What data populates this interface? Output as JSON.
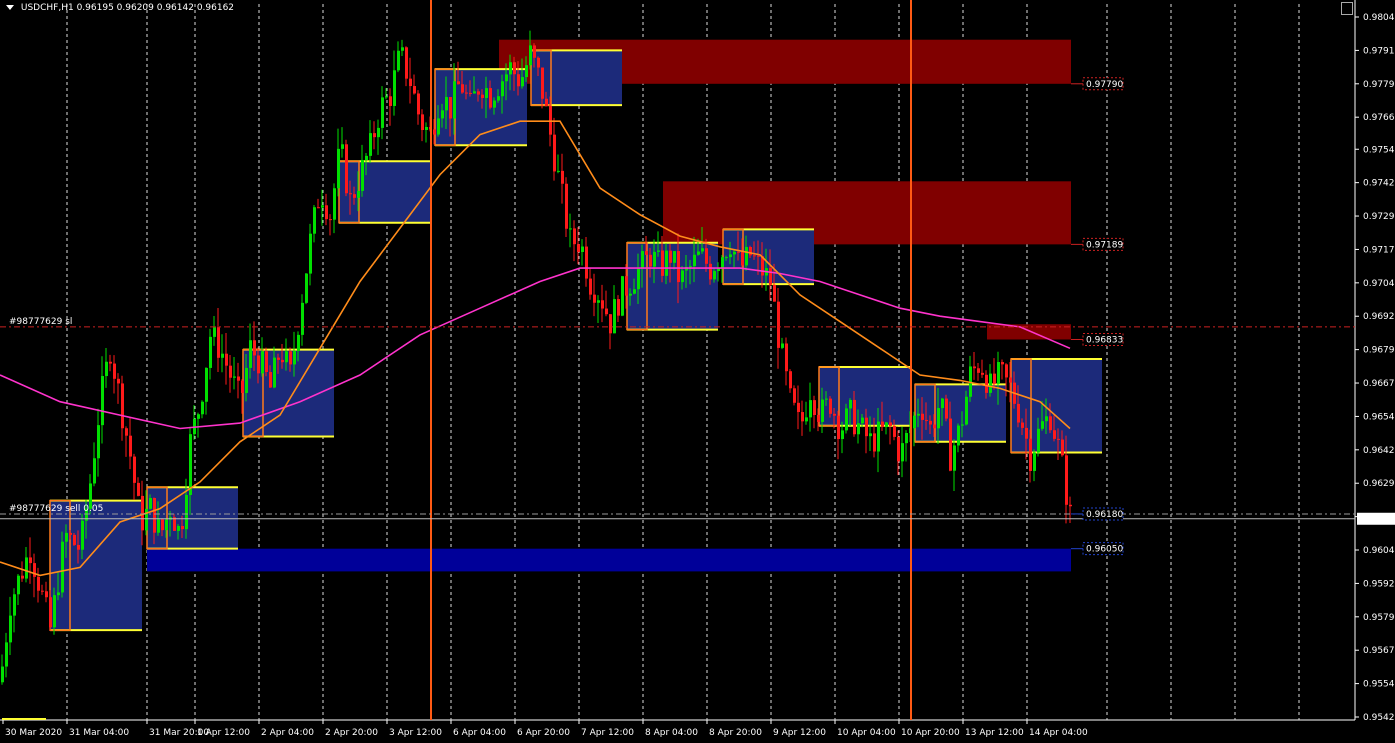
{
  "header": {
    "symbol_timeframe": "USDCHF,H1",
    "ohlc": "0.96195 0.96209 0.96142 0.96162"
  },
  "colors": {
    "background": "#000000",
    "bull_candle": "#00e000",
    "bear_candle": "#ff1a1a",
    "ma_fast": "#ff8c1a",
    "ma_slow": "#ff33cc",
    "supply_zone": "#800000",
    "demand_zone": "#000099",
    "range_box": "#1c2a7a",
    "vertical_marker": "#ff5a14",
    "sl_line": "#cc2222"
  },
  "orders": {
    "sl_label": "#98777629 sl",
    "entry_label": "#98777629 sell 0.05"
  },
  "zone_labels": {
    "z1": "0.97790",
    "z2": "0.97189",
    "z3": "0.96833",
    "z4": "0.96180",
    "z5": "0.96050"
  },
  "current_price_label": "0.96162",
  "chart_data": {
    "type": "candlestick",
    "title": "USDCHF,H1",
    "y_axis_ticks": [
      "0.98040",
      "0.97915",
      "0.97790",
      "0.97665",
      "0.97545",
      "0.97420",
      "0.97295",
      "0.97170",
      "0.97045",
      "0.96920",
      "0.96795",
      "0.96670",
      "0.96545",
      "0.96420",
      "0.96295",
      "0.96170",
      "0.96045",
      "0.95920",
      "0.95795",
      "0.95670",
      "0.95545",
      "0.95420"
    ],
    "ylim": [
      0.954,
      0.9806
    ],
    "x_axis_ticks": [
      "30 Mar 2020",
      "31 Mar 04:00",
      "31 Mar 20:00",
      "1 Apr 12:00",
      "2 Apr 04:00",
      "2 Apr 20:00",
      "3 Apr 12:00",
      "6 Apr 04:00",
      "6 Apr 20:00",
      "7 Apr 12:00",
      "8 Apr 04:00",
      "8 Apr 20:00",
      "9 Apr 12:00",
      "10 Apr 04:00",
      "10 Apr 20:00",
      "13 Apr 12:00",
      "14 Apr 04:00"
    ],
    "current_price": 0.96162,
    "sl_price": 0.9688,
    "entry_price": 0.9618,
    "price_path": [
      [
        0,
        0.9555
      ],
      [
        10,
        0.9585
      ],
      [
        30,
        0.9605
      ],
      [
        50,
        0.9575
      ],
      [
        65,
        0.961
      ],
      [
        80,
        0.9605
      ],
      [
        90,
        0.963
      ],
      [
        100,
        0.966
      ],
      [
        110,
        0.968
      ],
      [
        120,
        0.966
      ],
      [
        130,
        0.964
      ],
      [
        140,
        0.9615
      ],
      [
        150,
        0.962
      ],
      [
        160,
        0.961
      ],
      [
        170,
        0.962
      ],
      [
        180,
        0.961
      ],
      [
        190,
        0.9645
      ],
      [
        200,
        0.966
      ],
      [
        210,
        0.9685
      ],
      [
        220,
        0.968
      ],
      [
        230,
        0.967
      ],
      [
        240,
        0.966
      ],
      [
        250,
        0.968
      ],
      [
        260,
        0.9675
      ],
      [
        270,
        0.9665
      ],
      [
        280,
        0.968
      ],
      [
        290,
        0.967
      ],
      [
        300,
        0.9695
      ],
      [
        310,
        0.972
      ],
      [
        320,
        0.974
      ],
      [
        330,
        0.973
      ],
      [
        340,
        0.9755
      ],
      [
        350,
        0.9735
      ],
      [
        360,
        0.9745
      ],
      [
        370,
        0.9755
      ],
      [
        380,
        0.977
      ],
      [
        390,
        0.9775
      ],
      [
        400,
        0.979
      ],
      [
        410,
        0.978
      ],
      [
        420,
        0.9765
      ],
      [
        430,
        0.976
      ],
      [
        440,
        0.9775
      ],
      [
        450,
        0.977
      ],
      [
        460,
        0.978
      ],
      [
        470,
        0.977
      ],
      [
        480,
        0.978
      ],
      [
        490,
        0.9775
      ],
      [
        500,
        0.978
      ],
      [
        510,
        0.9785
      ],
      [
        520,
        0.978
      ],
      [
        530,
        0.979
      ],
      [
        540,
        0.978
      ],
      [
        550,
        0.976
      ],
      [
        560,
        0.974
      ],
      [
        570,
        0.972
      ],
      [
        580,
        0.972
      ],
      [
        590,
        0.9705
      ],
      [
        600,
        0.97
      ],
      [
        610,
        0.969
      ],
      [
        620,
        0.97
      ],
      [
        630,
        0.9705
      ],
      [
        640,
        0.971
      ],
      [
        650,
        0.9715
      ],
      [
        660,
        0.971
      ],
      [
        670,
        0.9715
      ],
      [
        680,
        0.9705
      ],
      [
        690,
        0.971
      ],
      [
        700,
        0.9715
      ],
      [
        710,
        0.971
      ],
      [
        720,
        0.9715
      ],
      [
        730,
        0.972
      ],
      [
        740,
        0.971
      ],
      [
        750,
        0.9715
      ],
      [
        760,
        0.971
      ],
      [
        770,
        0.9705
      ],
      [
        780,
        0.968
      ],
      [
        790,
        0.966
      ],
      [
        800,
        0.965
      ],
      [
        810,
        0.9665
      ],
      [
        820,
        0.9655
      ],
      [
        830,
        0.966
      ],
      [
        840,
        0.965
      ],
      [
        850,
        0.9655
      ],
      [
        860,
        0.965
      ],
      [
        870,
        0.9645
      ],
      [
        880,
        0.9648
      ],
      [
        890,
        0.965
      ],
      [
        900,
        0.964
      ],
      [
        910,
        0.965
      ],
      [
        920,
        0.966
      ],
      [
        930,
        0.965
      ],
      [
        940,
        0.966
      ],
      [
        950,
        0.964
      ],
      [
        960,
        0.965
      ],
      [
        970,
        0.967
      ],
      [
        980,
        0.9675
      ],
      [
        990,
        0.9665
      ],
      [
        1000,
        0.967
      ],
      [
        1010,
        0.9665
      ],
      [
        1020,
        0.9655
      ],
      [
        1030,
        0.964
      ],
      [
        1040,
        0.965
      ],
      [
        1050,
        0.9655
      ],
      [
        1060,
        0.964
      ],
      [
        1070,
        0.9617
      ]
    ],
    "ma_fast_path": [
      [
        0,
        0.96
      ],
      [
        40,
        0.9595
      ],
      [
        80,
        0.9598
      ],
      [
        120,
        0.9615
      ],
      [
        160,
        0.962
      ],
      [
        200,
        0.963
      ],
      [
        240,
        0.9645
      ],
      [
        280,
        0.9655
      ],
      [
        320,
        0.968
      ],
      [
        360,
        0.9705
      ],
      [
        400,
        0.9725
      ],
      [
        440,
        0.9745
      ],
      [
        480,
        0.976
      ],
      [
        520,
        0.9765
      ],
      [
        560,
        0.9765
      ],
      [
        600,
        0.974
      ],
      [
        640,
        0.973
      ],
      [
        680,
        0.9722
      ],
      [
        720,
        0.9718
      ],
      [
        760,
        0.9715
      ],
      [
        800,
        0.97
      ],
      [
        840,
        0.969
      ],
      [
        880,
        0.968
      ],
      [
        920,
        0.967
      ],
      [
        960,
        0.9668
      ],
      [
        1000,
        0.9665
      ],
      [
        1040,
        0.966
      ],
      [
        1070,
        0.965
      ]
    ],
    "ma_slow_path": [
      [
        0,
        0.967
      ],
      [
        60,
        0.966
      ],
      [
        120,
        0.9655
      ],
      [
        180,
        0.965
      ],
      [
        240,
        0.9652
      ],
      [
        300,
        0.966
      ],
      [
        360,
        0.967
      ],
      [
        420,
        0.9685
      ],
      [
        480,
        0.9695
      ],
      [
        540,
        0.9705
      ],
      [
        580,
        0.971
      ],
      [
        620,
        0.971
      ],
      [
        660,
        0.971
      ],
      [
        700,
        0.971
      ],
      [
        740,
        0.971
      ],
      [
        780,
        0.9708
      ],
      [
        820,
        0.9705
      ],
      [
        860,
        0.97
      ],
      [
        900,
        0.9695
      ],
      [
        940,
        0.9692
      ],
      [
        980,
        0.969
      ],
      [
        1020,
        0.9688
      ],
      [
        1070,
        0.968
      ]
    ],
    "supply_zones": [
      {
        "x0": 499,
        "x1": 1071,
        "top": 0.97955,
        "bottom": 0.9779,
        "label": "0.97790"
      },
      {
        "x0": 663,
        "x1": 1071,
        "top": 0.97425,
        "bottom": 0.97189,
        "label": "0.97189"
      },
      {
        "x0": 987,
        "x1": 1071,
        "top": 0.9689,
        "bottom": 0.96833,
        "label": "0.96833"
      }
    ],
    "demand_zones": [
      {
        "x0": 147,
        "x1": 1071,
        "top": 0.9605,
        "bottom": 0.95965,
        "label": "0.96050"
      }
    ],
    "range_boxes": [
      {
        "x0": 50,
        "x1": 142,
        "top": 0.9623,
        "bottom": 0.95745
      },
      {
        "x0": 147,
        "x1": 238,
        "top": 0.9628,
        "bottom": 0.9605
      },
      {
        "x0": 243,
        "x1": 334,
        "top": 0.96795,
        "bottom": 0.9647
      },
      {
        "x0": 339,
        "x1": 430,
        "top": 0.975,
        "bottom": 0.9727
      },
      {
        "x0": 435,
        "x1": 527,
        "top": 0.97845,
        "bottom": 0.9756
      },
      {
        "x0": 531,
        "x1": 622,
        "top": 0.97915,
        "bottom": 0.9771
      },
      {
        "x0": 627,
        "x1": 718,
        "top": 0.97195,
        "bottom": 0.9687
      },
      {
        "x0": 723,
        "x1": 814,
        "top": 0.97245,
        "bottom": 0.9704
      },
      {
        "x0": 819,
        "x1": 910,
        "top": 0.9673,
        "bottom": 0.9651
      },
      {
        "x0": 915,
        "x1": 1006,
        "top": 0.96665,
        "bottom": 0.9645
      },
      {
        "x0": 1011,
        "x1": 1102,
        "top": 0.9676,
        "bottom": 0.9641
      }
    ],
    "vertical_markers_x": [
      431,
      911
    ],
    "grid": true
  }
}
